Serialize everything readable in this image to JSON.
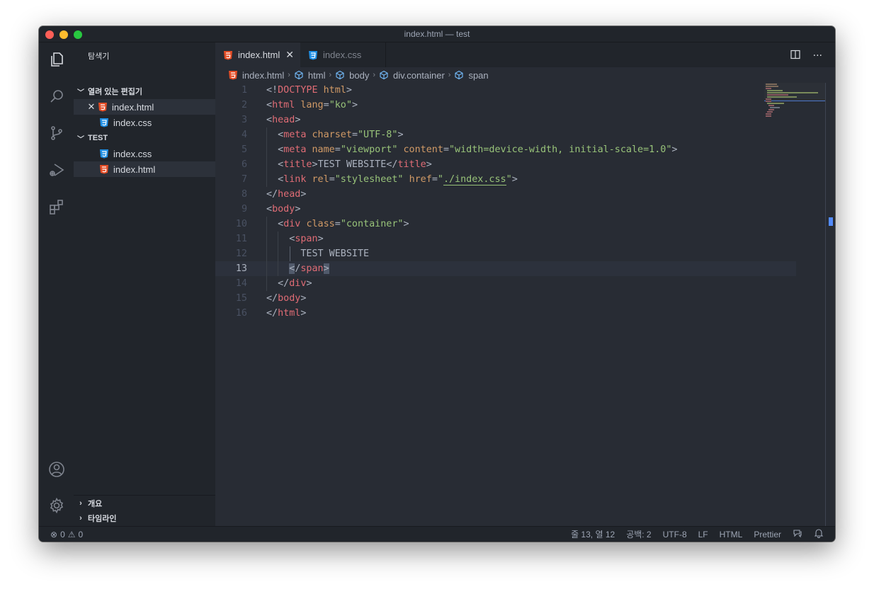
{
  "window": {
    "title": "index.html — test"
  },
  "activity_bar": {
    "items": [
      "explorer-icon",
      "search-icon",
      "source-control-icon",
      "run-debug-icon",
      "extensions-icon"
    ],
    "bottom": [
      "account-icon",
      "settings-gear-icon"
    ]
  },
  "sidebar": {
    "title": "탐색기",
    "open_editors": {
      "label": "열려 있는 편집기",
      "items": [
        {
          "name": "index.html",
          "type": "html",
          "close": "✕",
          "selected": true
        },
        {
          "name": "index.css",
          "type": "css",
          "selected": false
        }
      ]
    },
    "folder": {
      "label": "TEST",
      "items": [
        {
          "name": "index.css",
          "type": "css",
          "selected": false
        },
        {
          "name": "index.html",
          "type": "html",
          "selected": true
        }
      ]
    },
    "outline_label": "개요",
    "timeline_label": "타임라인"
  },
  "tabs": [
    {
      "label": "index.html",
      "type": "html",
      "active": true,
      "close": "✕"
    },
    {
      "label": "index.css",
      "type": "css",
      "active": false
    }
  ],
  "breadcrumb": [
    "index.html",
    "html",
    "body",
    "div.container",
    "span"
  ],
  "code": {
    "current_line": 13,
    "lines": [
      "1",
      "2",
      "3",
      "4",
      "5",
      "6",
      "7",
      "8",
      "9",
      "10",
      "11",
      "12",
      "13",
      "14",
      "15",
      "16"
    ],
    "tokens": {
      "doctype_open": "<!",
      "doctype_kw": "DOCTYPE",
      "doctype_html": "html",
      "doctype_close": ">",
      "html": "html",
      "lang_attr": "lang",
      "lang_val": "\"ko\"",
      "head": "head",
      "meta": "meta",
      "charset_attr": "charset",
      "charset_val": "\"UTF-8\"",
      "name_attr": "name",
      "name_val": "\"viewport\"",
      "content_attr": "content",
      "content_val": "\"width=device-width, initial-scale=1.0\"",
      "title": "title",
      "title_text": "TEST WEBSITE",
      "link": "link",
      "rel_attr": "rel",
      "rel_val": "\"stylesheet\"",
      "href_attr": "href",
      "href_q1": "\"",
      "href_path": "./index.css",
      "href_q2": "\"",
      "body": "body",
      "div": "div",
      "class_attr": "class",
      "class_val": "\"container\"",
      "span": "span",
      "span_text": "TEST WEBSITE"
    }
  },
  "status": {
    "errors_icon": "⊗",
    "errors": "0",
    "warnings_icon": "⚠",
    "warnings": "0",
    "position": "줄 13, 열 12",
    "spaces": "공백: 2",
    "encoding": "UTF-8",
    "eol": "LF",
    "language": "HTML",
    "formatter": "Prettier"
  },
  "colors": {
    "html_icon": "#e44d26",
    "css_icon": "#1f8fe5",
    "tag": "#e06c75",
    "attr": "#d19a66",
    "string": "#98c379",
    "keyword": "#c678dd"
  }
}
